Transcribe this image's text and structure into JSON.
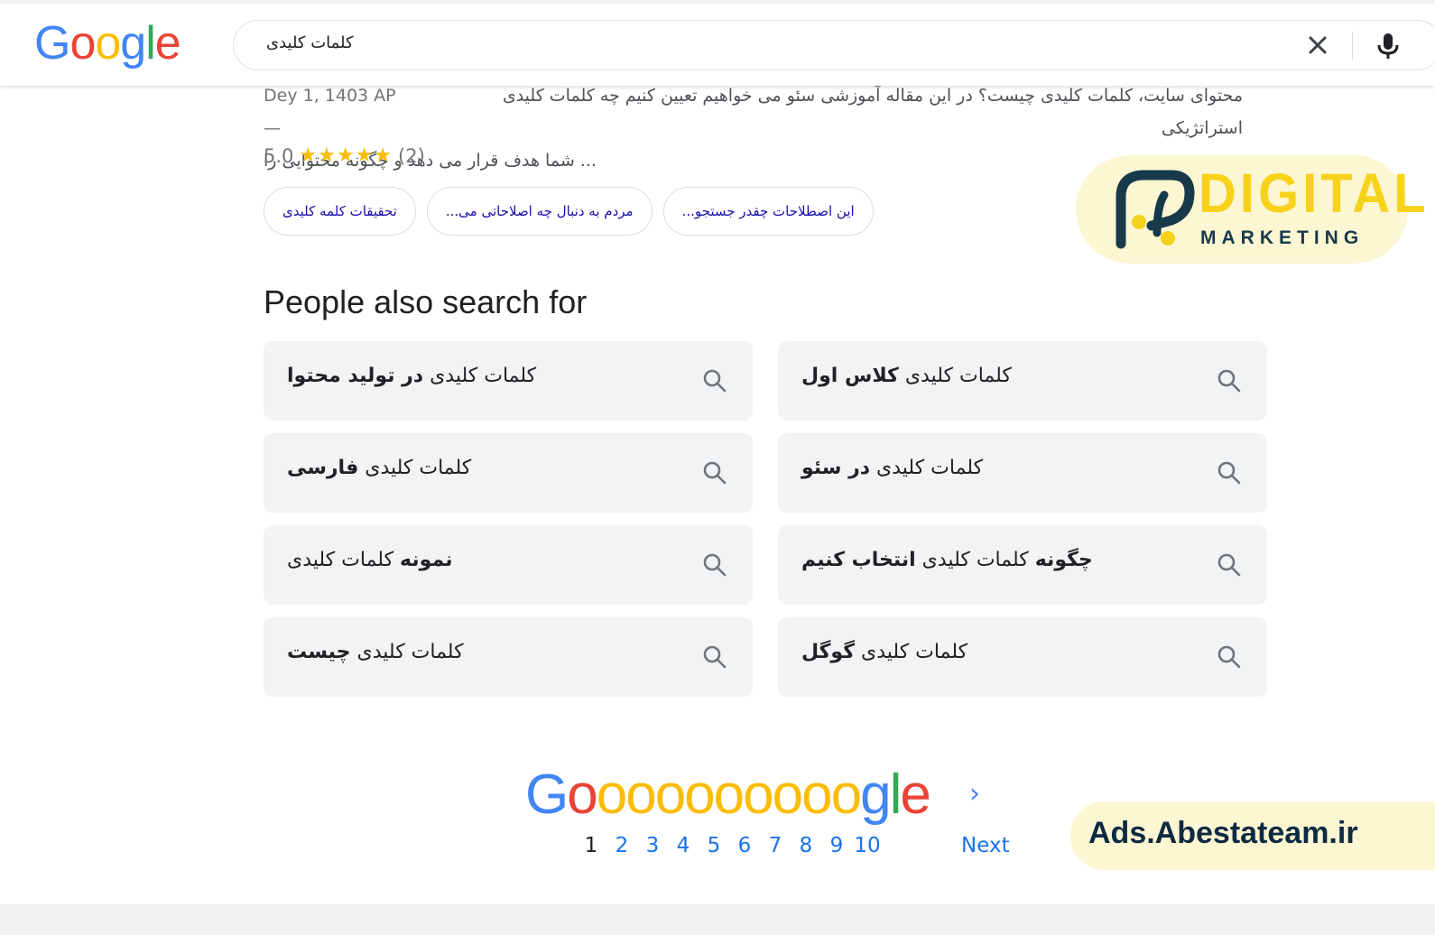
{
  "header": {
    "logo_letters": [
      "G",
      "o",
      "o",
      "g",
      "l",
      "e"
    ],
    "query": "کلمات کلیدی",
    "clear_icon": "close-icon",
    "mic_icon": "microphone-icon"
  },
  "result": {
    "date": "Dey 1, 1403 AP —",
    "snippet_line1": "محتوای سایت، کلمات کلیدی چیست؟ در این مقاله آموزشی سئو می خواهیم تعیین کنیم چه کلمات کلیدی استراتژیکی",
    "snippet_line2": "... شما هدف قرار می دهد و چگونه محتوایی را",
    "rating_value": "5.0",
    "rating_stars": "★★★★★",
    "rating_count": "(2)"
  },
  "chips": [
    {
      "label": "تحقیقات کلمه کلیدی"
    },
    {
      "label": "مردم به دنبال چه اصلاحاتی می..."
    },
    {
      "label": "این اصطلاحات چقدر جستجو..."
    }
  ],
  "brand": {
    "word": "DIGITAL",
    "sub": "MARKETING",
    "colors": {
      "yellow": "#F6D21A",
      "navy": "#173A4B",
      "badge_bg": "#FDF6D2"
    }
  },
  "people_also_search": {
    "title": "People also search for",
    "items": [
      {
        "plain": "کلمات کلیدی ",
        "bold": "در تولید محتوا",
        "bold_first": false
      },
      {
        "plain": "کلمات کلیدی ",
        "bold": "کلاس اول",
        "bold_first": false
      },
      {
        "plain": "کلمات کلیدی ",
        "bold": "فارسی",
        "bold_first": false
      },
      {
        "plain": "کلمات کلیدی ",
        "bold": "در سئو",
        "bold_first": false
      },
      {
        "plain": " کلمات کلیدی",
        "bold": "نمونه",
        "bold_first": true
      },
      {
        "plain": " کلمات کلیدی ",
        "bold": "چگونه",
        "bold2": "انتخاب کنیم",
        "bold_first": true
      },
      {
        "plain": "کلمات کلیدی ",
        "bold": "چیست",
        "bold_first": false
      },
      {
        "plain": "کلمات کلیدی ",
        "bold": "گوگل",
        "bold_first": false
      }
    ],
    "item_icon": "search-icon"
  },
  "pagination": {
    "logo_text": "Goooooooooogle",
    "pages": [
      "1",
      "2",
      "3",
      "4",
      "5",
      "6",
      "7",
      "8",
      "9",
      "10"
    ],
    "current_page": "1",
    "next_label": "Next",
    "next_icon": "chevron-right-icon"
  },
  "ads_badge": {
    "text": "Ads.Abestateam.ir"
  }
}
